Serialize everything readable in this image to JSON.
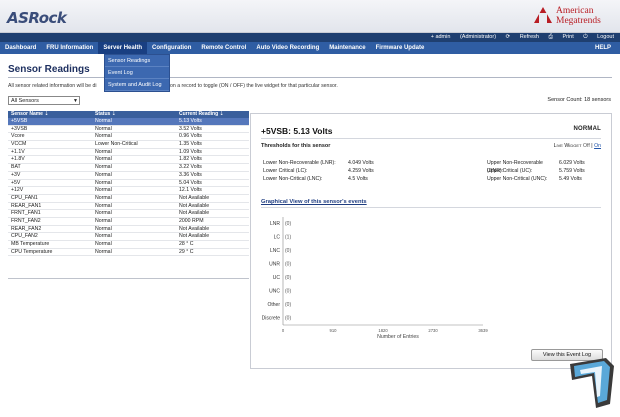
{
  "header": {
    "logo": "ASRock",
    "vendor_line1": "American",
    "vendor_line2": "Megatrends"
  },
  "infobar": {
    "user": "+ admin",
    "role": "(Administrator)",
    "refresh": "Refresh",
    "print": "Print",
    "logout": "Logout"
  },
  "menu": {
    "items": [
      "Dashboard",
      "FRU Information",
      "Server Health",
      "Configuration",
      "Remote Control",
      "Auto Video Recording",
      "Maintenance",
      "Firmware Update"
    ],
    "help": "HELP",
    "dropdown": [
      "Sensor Readings",
      "Event Log",
      "System and Audit Log"
    ]
  },
  "page": {
    "title": "Sensor Readings",
    "description": "All sensor related information will be di",
    "description_tail": "on a record to toggle (ON / OFF) the live widget for that particular sensor.",
    "filter_value": "All Sensors",
    "sensor_count": "Sensor Count: 18 sensors"
  },
  "table": {
    "headers": [
      "Sensor Name",
      "Status",
      "Current Reading"
    ],
    "rows": [
      [
        "+5VSB",
        "Normal",
        "5.13 Volts"
      ],
      [
        "+3VSB",
        "Normal",
        "3.52 Volts"
      ],
      [
        "Vcore",
        "Normal",
        "0.96 Volts"
      ],
      [
        "VCCM",
        "Lower Non-Critical",
        "1.35 Volts"
      ],
      [
        "+1.1V",
        "Normal",
        "1.09 Volts"
      ],
      [
        "+1.8V",
        "Normal",
        "1.82 Volts"
      ],
      [
        "BAT",
        "Normal",
        "3.22 Volts"
      ],
      [
        "+3V",
        "Normal",
        "3.36 Volts"
      ],
      [
        "+5V",
        "Normal",
        "5.04 Volts"
      ],
      [
        "+12V",
        "Normal",
        "12.1 Volts"
      ],
      [
        "CPU_FAN1",
        "Normal",
        "Not Available"
      ],
      [
        "REAR_FAN1",
        "Normal",
        "Not Available"
      ],
      [
        "FRNT_FAN1",
        "Normal",
        "Not Available"
      ],
      [
        "FRNT_FAN2",
        "Normal",
        "2000 RPM"
      ],
      [
        "REAR_FAN2",
        "Normal",
        "Not Available"
      ],
      [
        "CPU_FAN2",
        "Normal",
        "Not Available"
      ],
      [
        "MB Temperature",
        "Normal",
        "28 ° C"
      ],
      [
        "CPU Temperature",
        "Normal",
        "29 ° C"
      ]
    ]
  },
  "detail": {
    "title": "+5VSB: 5.13 Volts",
    "status": "NORMAL",
    "thresholds_label": "Thresholds for this sensor",
    "live_widget": "Live Widget",
    "off": "Off",
    "sep": "|",
    "on": "On",
    "left": [
      [
        "Lower Non-Recoverable (LNR):",
        "4.049 Volts"
      ],
      [
        "Lower Critical (LC):",
        "4.259 Volts"
      ],
      [
        "Lower Non-Critical (LNC):",
        "4.5 Volts"
      ]
    ],
    "right": [
      [
        "Upper Non-Recoverable (UNR):",
        "6.029 Volts"
      ],
      [
        "Upper Critical (UC):",
        "5.759 Volts"
      ],
      [
        "Upper Non-Critical (UNC):",
        "5.49 Volts"
      ]
    ],
    "graph_title": "Graphical View of this sensor's events",
    "button": "View this Event Log"
  },
  "chart_data": {
    "type": "bar",
    "categories": [
      "LNR",
      "LC",
      "LNC",
      "UNR",
      "UC",
      "UNC",
      "Other",
      "Discrete"
    ],
    "values": [
      0,
      1,
      0,
      0,
      0,
      0,
      0,
      0
    ],
    "value_labels": [
      "(0)",
      "(1)",
      "(0)",
      "(0)",
      "(0)",
      "(0)",
      "(0)",
      "(0)"
    ],
    "x_ticks": [
      "0",
      "910",
      "1820",
      "2730",
      "3639"
    ],
    "xlabel": "Number of Entries",
    "xlim": [
      0,
      3639
    ],
    "orientation": "horizontal"
  }
}
